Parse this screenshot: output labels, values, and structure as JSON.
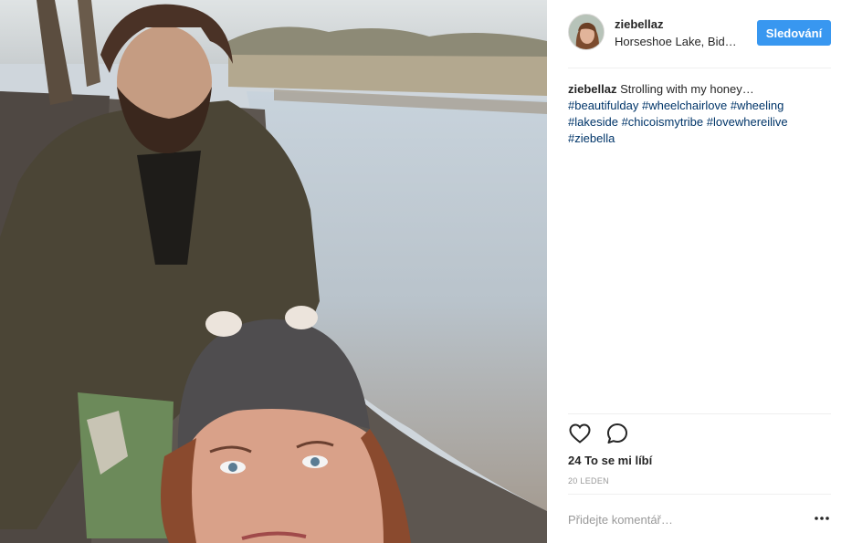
{
  "post": {
    "username": "ziebellaz",
    "location": "Horseshoe Lake, Bid…",
    "follow_label": "Sledování",
    "caption": {
      "username": "ziebellaz",
      "text": "Strolling with my honey…",
      "hashtags": [
        "#beautifulday",
        "#wheelchairlove",
        "#wheeling",
        "#lakeside",
        "#chicoismytribe",
        "#lovewhereilive",
        "#ziebella"
      ]
    },
    "likes": "24 To se mi líbí",
    "date": "20 LEDEN",
    "comment_placeholder": "Přidejte komentář…"
  },
  "icons": {
    "like": "heart-outline-icon",
    "comment": "speech-bubble-icon",
    "more": "more-options-icon"
  },
  "colors": {
    "follow_button": "#3897f0",
    "hashtag": "#003569",
    "text": "#262626",
    "muted": "#999999"
  }
}
